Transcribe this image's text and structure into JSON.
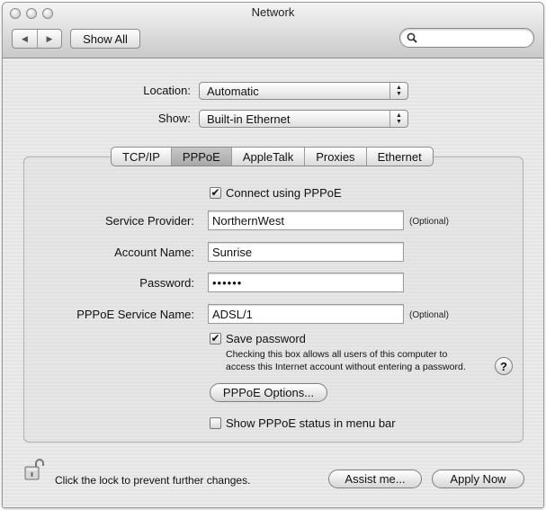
{
  "window": {
    "title": "Network"
  },
  "toolbar": {
    "back_glyph": "◀",
    "forward_glyph": "▶",
    "show_all_label": "Show All",
    "search_value": ""
  },
  "location": {
    "label": "Location:",
    "value": "Automatic"
  },
  "show": {
    "label": "Show:",
    "value": "Built-in Ethernet"
  },
  "tabs": [
    {
      "label": "TCP/IP",
      "selected": false
    },
    {
      "label": "PPPoE",
      "selected": true
    },
    {
      "label": "AppleTalk",
      "selected": false
    },
    {
      "label": "Proxies",
      "selected": false
    },
    {
      "label": "Ethernet",
      "selected": false
    }
  ],
  "pppoe": {
    "connect_label": "Connect using PPPoE",
    "connect_checked": true,
    "service_provider": {
      "label": "Service Provider:",
      "value": "NorthernWest",
      "hint": "(Optional)"
    },
    "account_name": {
      "label": "Account Name:",
      "value": "Sunrise"
    },
    "password": {
      "label": "Password:",
      "value": "••••••"
    },
    "service_name": {
      "label": "PPPoE Service Name:",
      "value": "ADSL/1",
      "hint": "(Optional)"
    },
    "save_password_label": "Save password",
    "save_password_checked": true,
    "save_password_note_line1": "Checking this box allows all users of this computer to",
    "save_password_note_line2": "access this Internet account without entering a password.",
    "options_button": "PPPoE Options...",
    "status_label": "Show PPPoE status in menu bar",
    "status_checked": false,
    "help_label": "?"
  },
  "footer": {
    "lock_text": "Click the lock to prevent further changes.",
    "assist_button": "Assist me...",
    "apply_button": "Apply Now"
  },
  "icons": [
    "close-icon",
    "minimize-icon",
    "zoom-icon",
    "search-icon",
    "checkmark-icon",
    "unlocked-padlock-icon",
    "chevron-updown-icon"
  ]
}
